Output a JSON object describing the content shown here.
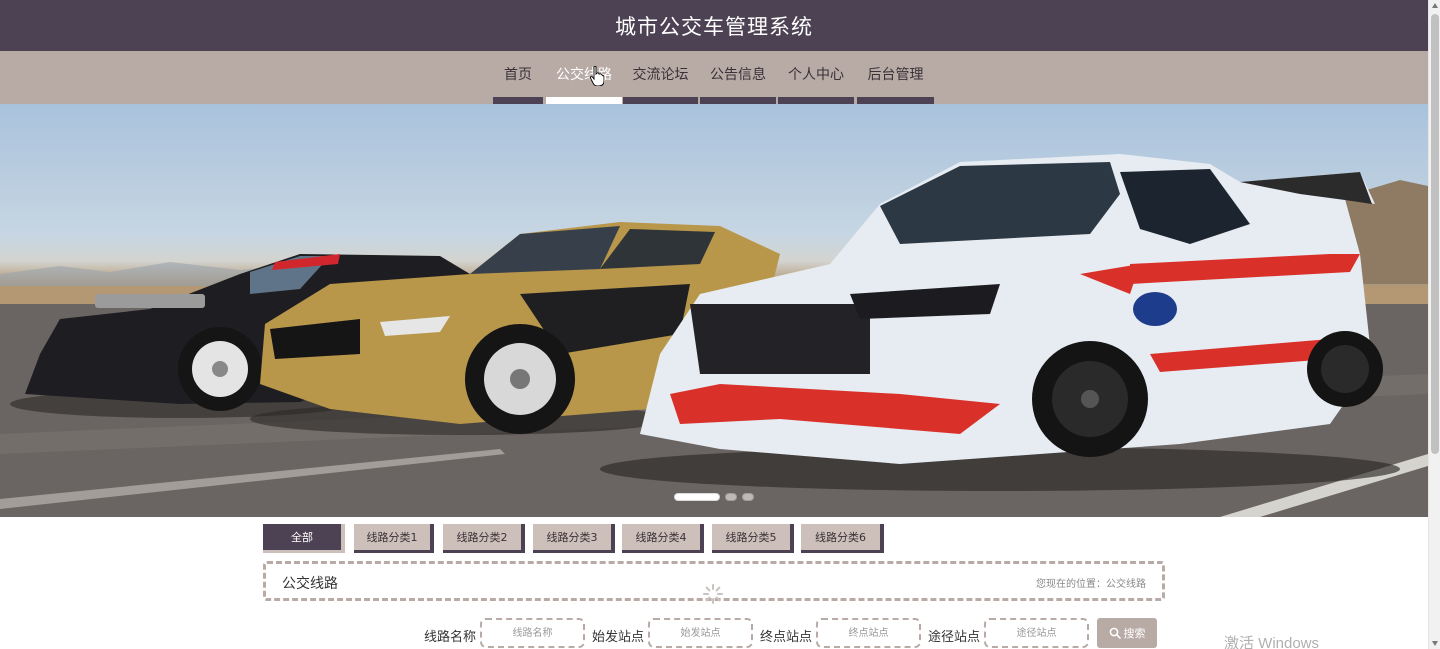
{
  "header": {
    "title": "城市公交车管理系统"
  },
  "nav": {
    "items": [
      {
        "label": "首页"
      },
      {
        "label": "公交线路"
      },
      {
        "label": "交流论坛"
      },
      {
        "label": "公告信息"
      },
      {
        "label": "个人中心"
      },
      {
        "label": "后台管理"
      }
    ],
    "active_index": 1
  },
  "banner": {
    "slide_count": 3,
    "active_slide": 1
  },
  "categories": {
    "tabs": [
      {
        "label": "全部"
      },
      {
        "label": "线路分类1"
      },
      {
        "label": "线路分类2"
      },
      {
        "label": "线路分类3"
      },
      {
        "label": "线路分类4"
      },
      {
        "label": "线路分类5"
      },
      {
        "label": "线路分类6"
      }
    ],
    "active_index": 0
  },
  "breadcrumb": {
    "heading": "公交线路",
    "position_text": "您现在的位置：公交线路"
  },
  "search": {
    "route_name": {
      "label": "线路名称",
      "placeholder": "线路名称"
    },
    "start_station": {
      "label": "始发站点",
      "placeholder": "始发站点"
    },
    "end_station": {
      "label": "终点站点",
      "placeholder": "终点站点"
    },
    "via_station": {
      "label": "途径站点",
      "placeholder": "途径站点"
    },
    "button_label": "搜索"
  },
  "os_watermark": "激活 Windows",
  "colors": {
    "header_bg": "#4d4253",
    "nav_bg": "#b8aba6",
    "tab_bg": "#cdbfb9",
    "accent": "#4d4253"
  }
}
